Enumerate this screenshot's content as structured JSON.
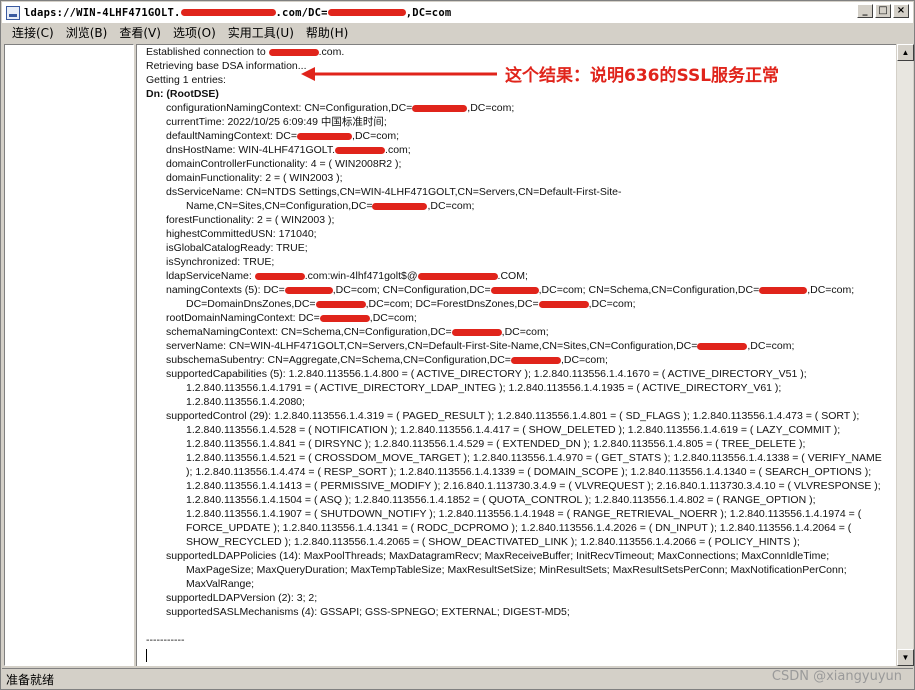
{
  "window": {
    "title_prefix": "ldaps://WIN-4LHF471GOLT.",
    "title_mid": ".com/DC=",
    "title_suffix": ",DC=com",
    "controls": {
      "minimize": "_",
      "maximize": "□",
      "close": "×"
    }
  },
  "menu": [
    "连接(C)",
    "浏览(B)",
    "查看(V)",
    "选项(O)",
    "实用工具(U)",
    "帮助(H)"
  ],
  "annotation": {
    "text": "这个结果：说明636的SSL服务正常",
    "color": "#e0241b"
  },
  "log": {
    "l01a": "Established connection to ",
    "l01b": ".com.",
    "l02": "Retrieving base DSA information...",
    "l03": "Getting 1 entries:",
    "l04": "Dn: (RootDSE)",
    "l05a": "configurationNamingContext: CN=Configuration,DC=",
    "l05b": ",DC=com;",
    "l06": "currentTime: 2022/10/25 6:09:49 中国标准时间;",
    "l07a": "defaultNamingContext: DC=",
    "l07b": ",DC=com;",
    "l08a": "dnsHostName: WIN-4LHF471GOLT.",
    "l08b": ".com;",
    "l09": "domainControllerFunctionality: 4 = ( WIN2008R2 );",
    "l10": "domainFunctionality: 2 = ( WIN2003 );",
    "l11": "dsServiceName: CN=NTDS Settings,CN=WIN-4LHF471GOLT,CN=Servers,CN=Default-First-Site-",
    "l12a": "Name,CN=Sites,CN=Configuration,DC=",
    "l12b": ",DC=com;",
    "l13": "forestFunctionality: 2 = ( WIN2003 );",
    "l14": "highestCommittedUSN: 171040;",
    "l15": "isGlobalCatalogReady: TRUE;",
    "l16": "isSynchronized: TRUE;",
    "l17a": "ldapServiceName: ",
    "l17b": ".com:win-4lhf471golt$@",
    "l17c": ".COM;",
    "l18a": "namingContexts (5): DC=",
    "l18b": ",DC=com; CN=Configuration,DC=",
    "l18c": ",DC=com; CN=Schema,CN=Configuration,DC=",
    "l18d": ",DC=com;",
    "l19a": "DC=DomainDnsZones,DC=",
    "l19b": ",DC=com; DC=ForestDnsZones,DC=",
    "l19c": ",DC=com;",
    "l20a": "rootDomainNamingContext: DC=",
    "l20b": ",DC=com;",
    "l21a": "schemaNamingContext: CN=Schema,CN=Configuration,DC=",
    "l21b": ",DC=com;",
    "l22a": "serverName: CN=WIN-4LHF471GOLT,CN=Servers,CN=Default-First-Site-Name,CN=Sites,CN=Configuration,DC=",
    "l22b": ",DC=com;",
    "l23a": "subschemaSubentry: CN=Aggregate,CN=Schema,CN=Configuration,DC=",
    "l23b": ",DC=com;",
    "l24": "supportedCapabilities (5): 1.2.840.113556.1.4.800 = ( ACTIVE_DIRECTORY ); 1.2.840.113556.1.4.1670 = ( ACTIVE_DIRECTORY_V51 );",
    "l25": "1.2.840.113556.1.4.1791 = ( ACTIVE_DIRECTORY_LDAP_INTEG ); 1.2.840.113556.1.4.1935 = ( ACTIVE_DIRECTORY_V61 );",
    "l26": "1.2.840.113556.1.4.2080;",
    "l27": "supportedControl (29): 1.2.840.113556.1.4.319 = ( PAGED_RESULT ); 1.2.840.113556.1.4.801 = ( SD_FLAGS ); 1.2.840.113556.1.4.473 = ( SORT );",
    "l28": "1.2.840.113556.1.4.528 = ( NOTIFICATION ); 1.2.840.113556.1.4.417 = ( SHOW_DELETED ); 1.2.840.113556.1.4.619 = ( LAZY_COMMIT );",
    "l29": "1.2.840.113556.1.4.841 = ( DIRSYNC ); 1.2.840.113556.1.4.529 = ( EXTENDED_DN ); 1.2.840.113556.1.4.805 = ( TREE_DELETE );",
    "l30": "1.2.840.113556.1.4.521 = ( CROSSDOM_MOVE_TARGET ); 1.2.840.113556.1.4.970 = ( GET_STATS ); 1.2.840.113556.1.4.1338 = ( VERIFY_NAME",
    "l31": "); 1.2.840.113556.1.4.474 = ( RESP_SORT ); 1.2.840.113556.1.4.1339 = ( DOMAIN_SCOPE ); 1.2.840.113556.1.4.1340 = ( SEARCH_OPTIONS );",
    "l32": "1.2.840.113556.1.4.1413 = ( PERMISSIVE_MODIFY ); 2.16.840.1.113730.3.4.9 = ( VLVREQUEST ); 2.16.840.1.113730.3.4.10 = ( VLVRESPONSE );",
    "l33": "1.2.840.113556.1.4.1504 = ( ASQ ); 1.2.840.113556.1.4.1852 = ( QUOTA_CONTROL ); 1.2.840.113556.1.4.802 = ( RANGE_OPTION );",
    "l34": "1.2.840.113556.1.4.1907 = ( SHUTDOWN_NOTIFY ); 1.2.840.113556.1.4.1948 = ( RANGE_RETRIEVAL_NOERR ); 1.2.840.113556.1.4.1974 = (",
    "l35": "FORCE_UPDATE ); 1.2.840.113556.1.4.1341 = ( RODC_DCPROMO ); 1.2.840.113556.1.4.2026 = ( DN_INPUT ); 1.2.840.113556.1.4.2064 = (",
    "l36": "SHOW_RECYCLED ); 1.2.840.113556.1.4.2065 = ( SHOW_DEACTIVATED_LINK ); 1.2.840.113556.1.4.2066 = ( POLICY_HINTS );",
    "l37": "supportedLDAPPolicies (14): MaxPoolThreads; MaxDatagramRecv; MaxReceiveBuffer; InitRecvTimeout; MaxConnections; MaxConnIdleTime;",
    "l38": "MaxPageSize; MaxQueryDuration; MaxTempTableSize; MaxResultSetSize; MinResultSets; MaxResultSetsPerConn; MaxNotificationPerConn;",
    "l39": "MaxValRange;",
    "l40": "supportedLDAPVersion (2): 3; 2;",
    "l41": "supportedSASLMechanisms (4): GSSAPI; GSS-SPNEGO; EXTERNAL; DIGEST-MD5;",
    "l42": "-----------"
  },
  "status": {
    "text": "准备就绪"
  },
  "watermark": "CSDN @xiangyuyun"
}
